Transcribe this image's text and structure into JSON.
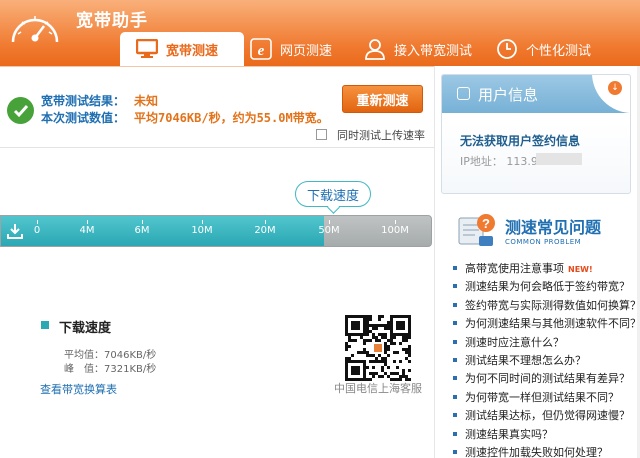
{
  "app": {
    "title": "宽带助手"
  },
  "tabs": [
    {
      "label": "宽带测速",
      "icon": "monitor-icon",
      "active": true
    },
    {
      "label": "网页测速",
      "icon": "ie-icon",
      "active": false
    },
    {
      "label": "接入带宽测试",
      "icon": "person-icon",
      "active": false
    },
    {
      "label": "个性化测试",
      "icon": "clock-icon",
      "active": false
    }
  ],
  "result": {
    "result_label": "宽带测试结果：",
    "result_value": "未知",
    "measure_label": "本次测试数值：",
    "measure_value": "平均7046KB/秒，约为55.0M带宽。",
    "retest_label": "重新测速",
    "upload_checkbox_label": "同时测试上传速率",
    "upload_checked": false
  },
  "meter": {
    "bubble_label": "下载速度",
    "ticks": [
      "0",
      "4M",
      "6M",
      "10M",
      "20M",
      "50M",
      "100M"
    ],
    "fill_fraction": 0.75
  },
  "stats": {
    "title": "下载速度",
    "avg": "平均值：7046KB/秒",
    "peak": "峰　值：7321KB/秒",
    "convert_link": "查看带宽换算表"
  },
  "qr": {
    "caption": "中国电信上海客服"
  },
  "user": {
    "title": "用户信息",
    "sign_info": "无法获取用户签约信息",
    "ip_label": "IP地址：  113.9"
  },
  "faq": {
    "title": "测速常见问题",
    "subtitle": "COMMON PROBLEM",
    "new_tag": "NEW!",
    "items": [
      "高带宽使用注意事项",
      "测速结果为何会略低于签约带宽？",
      "签约带宽与实际测得数值如何换算？",
      "为何测速结果与其他测速软件不同？",
      "测速时应注意什么？",
      "测试结果不理想怎么办？",
      "为何不同时间的测试结果有差异？",
      "为何带宽一样但测试结果不同？",
      "测试结果达标，但仍觉得网速慢？",
      "测速结果真实吗？",
      "测速控件加载失败如何处理？"
    ]
  },
  "colors": {
    "brand_orange": "#f07a30",
    "link_blue": "#1f6fb2",
    "meter_teal": "#2aa8b3",
    "success_green": "#48a23a"
  }
}
